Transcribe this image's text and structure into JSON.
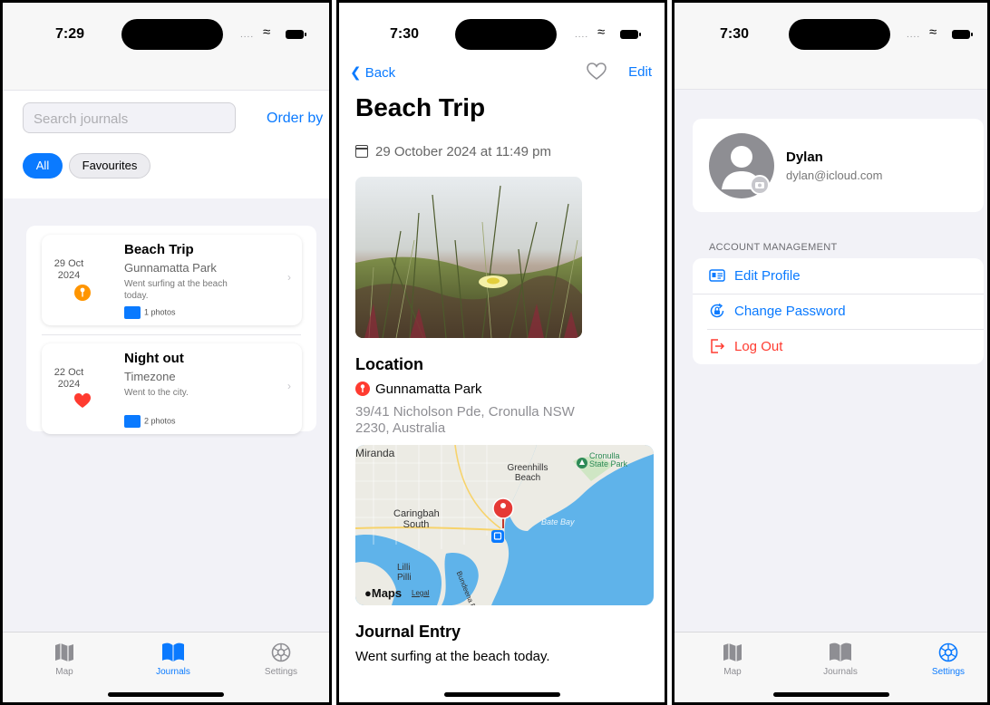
{
  "colors": {
    "accent": "#0a7aff",
    "danger": "#ff3b30",
    "favourite_marker": "#ff3b30",
    "pin_marker": "#ff9500"
  },
  "tabbar": {
    "map": "Map",
    "journals": "Journals",
    "settings": "Settings"
  },
  "journals_screen": {
    "time": "7:29",
    "search_placeholder": "Search journals",
    "order_by": "Order by",
    "filter_all": "All",
    "filter_favourites": "Favourites",
    "entries": [
      {
        "date_day": "29 Oct",
        "date_year": "2024",
        "title": "Beach Trip",
        "location": "Gunnamatta Park",
        "note": "Went surfing at the beach today.",
        "photos": "1 photos",
        "marker": "pin-icon"
      },
      {
        "date_day": "22 Oct",
        "date_year": "2024",
        "title": "Night out",
        "location": "Timezone",
        "note": "Went to the city.",
        "photos": "2 photos",
        "marker": "heart-icon"
      }
    ]
  },
  "detail_screen": {
    "time": "7:30",
    "back": "Back",
    "edit": "Edit",
    "title": "Beach Trip",
    "date": "29 October 2024 at 11:49 pm",
    "location_heading": "Location",
    "location_name": "Gunnamatta Park",
    "location_address": "39/41 Nicholson Pde, Cronulla NSW 2230, Australia",
    "map_labels": {
      "miranda": "Miranda",
      "greenhills": "Greenhills Beach",
      "cronulla": "Cronulla State Park",
      "caringbah": "Caringbah South",
      "bate_bay": "Bate Bay",
      "lilli": "Lilli Pilli",
      "bundeena": "Bundeena Ferry",
      "maps": "Maps",
      "legal": "Legal"
    },
    "journal_heading": "Journal Entry",
    "journal_text": "Went surfing at the beach today."
  },
  "settings_screen": {
    "time": "7:30",
    "name": "Dylan",
    "email": "dylan@icloud.com",
    "section": "ACCOUNT MANAGEMENT",
    "edit_profile": "Edit Profile",
    "change_password": "Change Password",
    "log_out": "Log Out"
  }
}
